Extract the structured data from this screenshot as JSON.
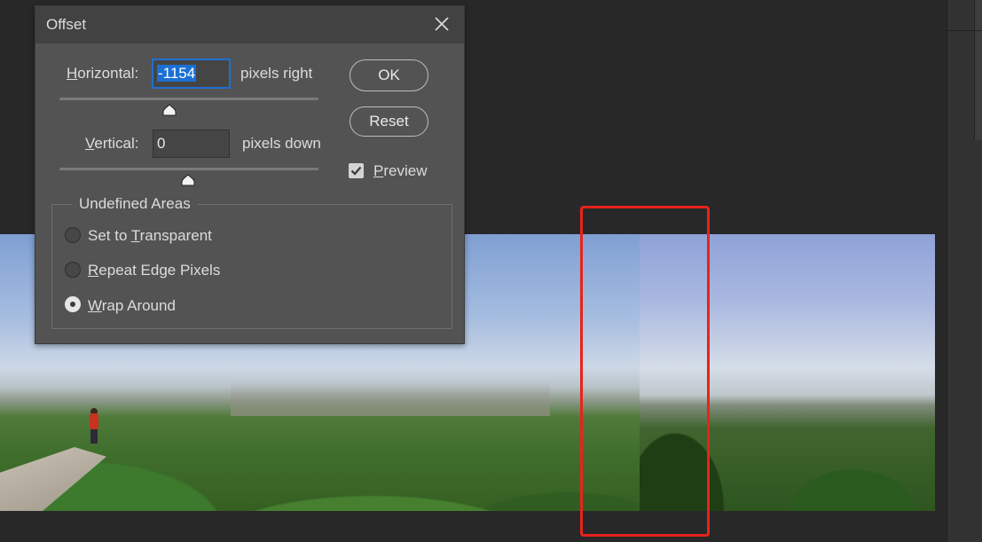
{
  "dialog": {
    "title": "Offset",
    "horizontal": {
      "label_underline": "H",
      "label_rest": "orizontal:",
      "value": "-1154",
      "unit": "pixels right"
    },
    "vertical": {
      "label_underline": "V",
      "label_rest": "ertical:",
      "value": "0",
      "unit": "pixels down"
    },
    "buttons": {
      "ok": "OK",
      "reset": "Reset"
    },
    "preview": {
      "label_underline": "P",
      "label_rest": "review",
      "checked": true
    },
    "undefined_areas": {
      "legend": "Undefined Areas",
      "options": [
        {
          "pre": "Set to ",
          "underline": "T",
          "post": "ransparent",
          "selected": false
        },
        {
          "pre": "",
          "underline": "R",
          "post": "epeat Edge Pixels",
          "selected": false
        },
        {
          "pre": "",
          "underline": "W",
          "post": "rap Around",
          "selected": true
        }
      ]
    }
  },
  "colors": {
    "highlight": "#e8231b",
    "selection": "#1a70d4",
    "dialog_bg": "#535353",
    "workspace_bg": "#282828"
  }
}
